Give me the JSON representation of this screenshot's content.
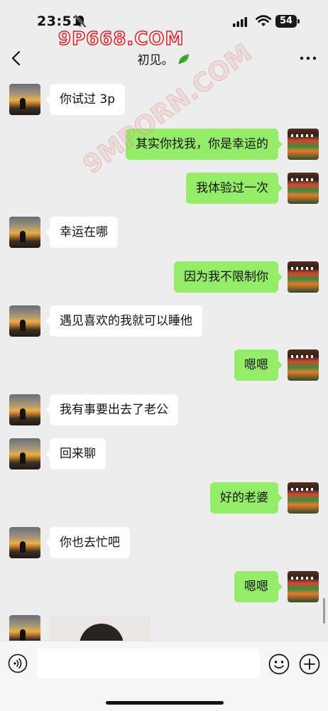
{
  "status_bar": {
    "time": "23:51",
    "battery": "54",
    "watermark": "9P668.COM"
  },
  "header": {
    "title": "初见。"
  },
  "watermark_diagonal": "9MPORN.COM",
  "messages": [
    {
      "side": "left",
      "text": "你试过 3p"
    },
    {
      "side": "right",
      "text": "其实你找我，你是幸运的"
    },
    {
      "side": "right",
      "text": "我体验过一次"
    },
    {
      "side": "left",
      "text": "幸运在哪"
    },
    {
      "side": "right",
      "text": "因为我不限制你"
    },
    {
      "side": "left",
      "text": "遇见喜欢的我就可以睡他"
    },
    {
      "side": "right",
      "text": "嗯嗯"
    },
    {
      "side": "left",
      "text": "我有事要出去了老公"
    },
    {
      "side": "left",
      "text": "回来聊"
    },
    {
      "side": "right",
      "text": "好的老婆"
    },
    {
      "side": "left",
      "text": "你也去忙吧"
    },
    {
      "side": "right",
      "text": "嗯嗯"
    }
  ],
  "input": {
    "placeholder": ""
  },
  "colors": {
    "self_bubble": "#95ec69",
    "other_bubble": "#ffffff",
    "background": "#ededed"
  },
  "icons": [
    "bell-off-icon",
    "signal-icon",
    "wifi-icon",
    "battery-icon",
    "back-icon",
    "leaf-icon",
    "more-icon",
    "voice-icon",
    "emoji-icon",
    "plus-icon"
  ]
}
